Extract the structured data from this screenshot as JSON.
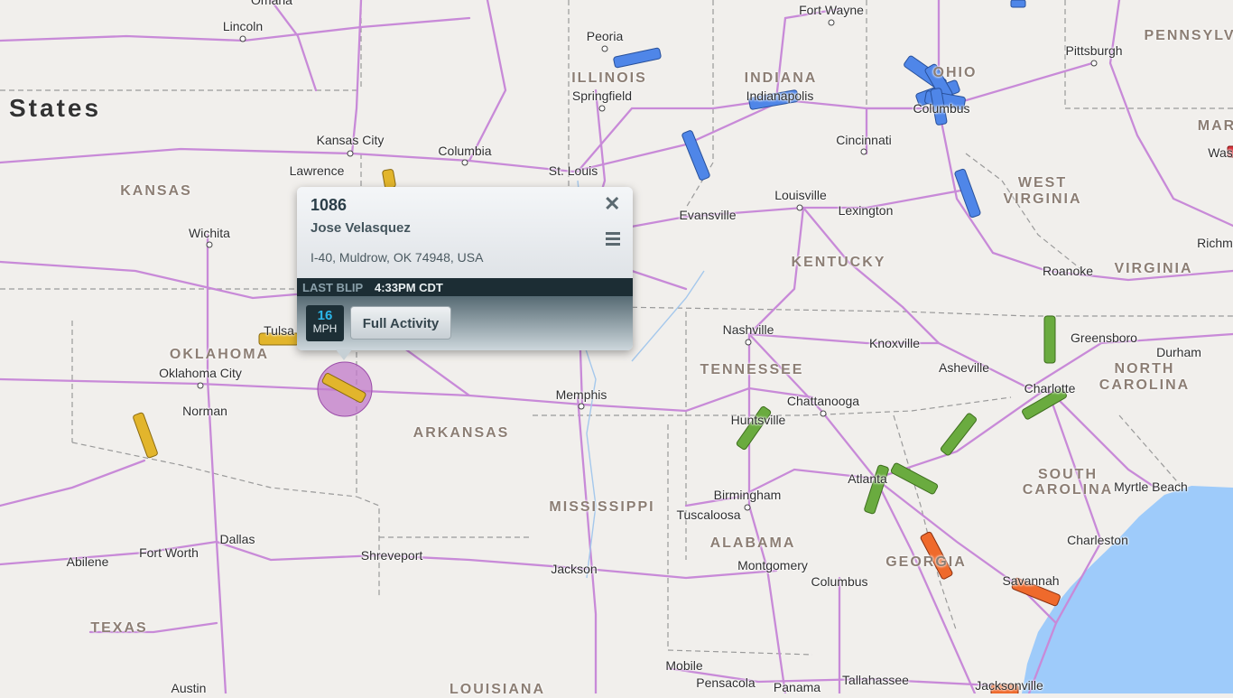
{
  "country_label": "States",
  "states": {
    "kansas": "KANSAS",
    "illinois": "ILLINOIS",
    "indiana": "INDIANA",
    "ohio": "OHIO",
    "pennsylvania": "PENNSYLV",
    "maryland": "MAR",
    "west_virginia_1": "WEST",
    "west_virginia_2": "VIRGINIA",
    "kentucky": "KENTUCKY",
    "virginia": "VIRGINIA",
    "oklahoma": "OKLAHOMA",
    "tennessee": "TENNESSEE",
    "north_carolina_1": "NORTH",
    "north_carolina_2": "CAROLINA",
    "arkansas": "ARKANSAS",
    "south_carolina_1": "SOUTH",
    "south_carolina_2": "CAROLINA",
    "mississippi": "MISSISSIPPI",
    "alabama": "ALABAMA",
    "georgia": "GEORGIA",
    "texas": "TEXAS",
    "louisiana": "LOUISIANA"
  },
  "cities": {
    "omaha": "Omaha",
    "lincoln": "Lincoln",
    "fort_wayne": "Fort Wayne",
    "peoria": "Peoria",
    "pittsburgh": "Pittsburgh",
    "springfield": "Springfield",
    "indianapolis": "Indianapolis",
    "columbus_oh": "Columbus",
    "kansas_city": "Kansas City",
    "columbia": "Columbia",
    "cincinnati": "Cincinnati",
    "lawrence": "Lawrence",
    "st_louis": "St. Louis",
    "washington": "Was",
    "louisville": "Louisville",
    "wichita": "Wichita",
    "evansville": "Evansville",
    "lexington": "Lexington",
    "richmond": "Richm",
    "roanoke": "Roanoke",
    "tulsa": "Tulsa",
    "nashville": "Nashville",
    "knoxville": "Knoxville",
    "greensboro": "Greensboro",
    "oklahoma_city": "Oklahoma City",
    "durham": "Durham",
    "asheville": "Asheville",
    "memphis": "Memphis",
    "chattanooga": "Chattanooga",
    "charlotte": "Charlotte",
    "norman": "Norman",
    "huntsville": "Huntsville",
    "atlanta": "Atlanta",
    "birmingham": "Birmingham",
    "myrtle_beach": "Myrtle Beach",
    "tuscaloosa": "Tuscaloosa",
    "fort_worth": "Fort Worth",
    "dallas": "Dallas",
    "shreveport": "Shreveport",
    "charleston": "Charleston",
    "abilene": "Abilene",
    "jackson": "Jackson",
    "montgomery": "Montgomery",
    "savannah": "Savannah",
    "columbus_ga": "Columbus",
    "mobile": "Mobile",
    "pensacola": "Pensacola",
    "tallahassee": "Tallahassee",
    "jacksonville": "Jacksonville",
    "austin": "Austin",
    "panama": "Panama"
  },
  "vehicle_colors": {
    "yellow": "#e2b52c",
    "blue": "#4f86e8",
    "green": "#6aab3f",
    "orange": "#ef6a2c",
    "selected_halo": "#c07ac9"
  },
  "popup": {
    "vehicle_id": "1086",
    "driver_name": "Jose Velasquez",
    "address": "I-40, Muldrow, OK 74948, USA",
    "last_blip_label": "LAST BLIP",
    "last_blip_time": "4:33PM CDT",
    "speed_value": "16",
    "speed_unit": "MPH",
    "full_activity_label": "Full Activity",
    "close_icon": "close-icon",
    "menu_icon": "hamburger-menu-icon"
  }
}
